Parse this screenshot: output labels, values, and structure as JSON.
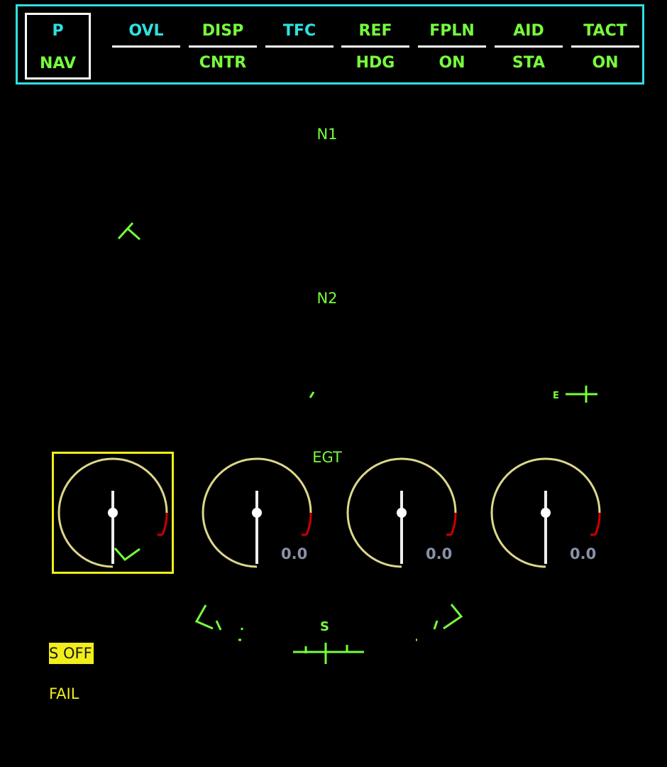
{
  "menu": {
    "page_key": {
      "top": "P",
      "bottom": "NAV"
    },
    "keys": [
      {
        "top": "OVL",
        "bottom": ""
      },
      {
        "top": "DISP",
        "bottom": "CNTR"
      },
      {
        "top": "TFC",
        "bottom": ""
      },
      {
        "top": "REF",
        "bottom": "HDG"
      },
      {
        "top": "FPLN",
        "bottom": "ON"
      },
      {
        "top": "AID",
        "bottom": "STA"
      },
      {
        "top": "TACT",
        "bottom": "ON"
      }
    ]
  },
  "engine": {
    "n1_label": "N1",
    "n2_label": "N2",
    "egt_label": "EGT",
    "gauges": [
      {
        "readout": "",
        "selected": true
      },
      {
        "readout": "0.0",
        "selected": false
      },
      {
        "readout": "0.0",
        "selected": false
      },
      {
        "readout": "0.0",
        "selected": false
      }
    ]
  },
  "hsi": {
    "letter": "S",
    "marker": "E"
  },
  "messages": {
    "msg1": "S OFF",
    "msg2": "FAIL"
  },
  "colors": {
    "frame": "#2fe0e0",
    "symbology": "#76ff3c",
    "caution": "#f2ee1a",
    "dial": "#ddd88a",
    "redline": "#cc0000"
  }
}
